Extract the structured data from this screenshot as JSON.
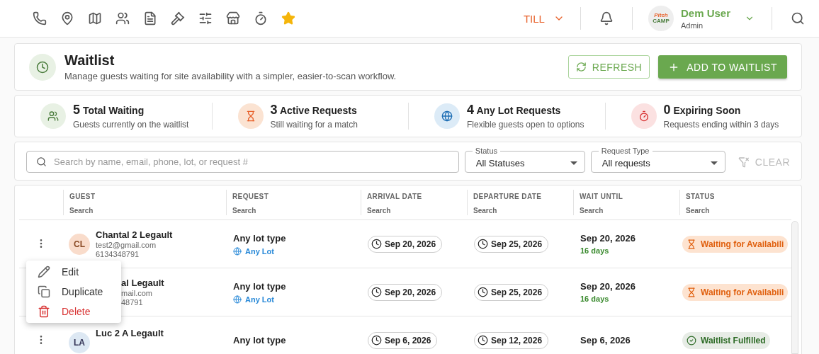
{
  "topbar": {
    "till": "TILL",
    "user": {
      "name": "Dem User",
      "role": "Admin",
      "logo_top": "Pitch",
      "logo_bottom": "CAMP"
    }
  },
  "header": {
    "title": "Waitlist",
    "subtitle": "Manage guests waiting for site availability with a simpler, easier-to-scan workflow.",
    "refresh": "REFRESH",
    "add": "ADD TO WAITLIST"
  },
  "stats": [
    {
      "kind": "group",
      "count": "5",
      "label": "Total Waiting",
      "caption": "Guests currently on the waitlist",
      "color": "#e8f1e4"
    },
    {
      "kind": "hourglass",
      "count": "3",
      "label": "Active Requests",
      "caption": "Still waiting for a match",
      "color": "#fbe3d2"
    },
    {
      "kind": "globe",
      "count": "4",
      "label": "Any Lot Requests",
      "caption": "Flexible guests open to options",
      "color": "#dcebf7"
    },
    {
      "kind": "timer",
      "count": "0",
      "label": "Expiring Soon",
      "caption": "Requests ending within 3 days",
      "color": "#fbe1e1"
    }
  ],
  "filters": {
    "search_placeholder": "Search by name, email, phone, lot, or request #",
    "status": {
      "label": "Status",
      "value": "All Statuses"
    },
    "request_type": {
      "label": "Request Type",
      "value": "All requests"
    },
    "clear": "CLEAR"
  },
  "table": {
    "columns": [
      {
        "title": "GUEST",
        "filter": "Search"
      },
      {
        "title": "REQUEST",
        "filter": "Search"
      },
      {
        "title": "ARRIVAL DATE",
        "filter": "Search"
      },
      {
        "title": "DEPARTURE DATE",
        "filter": "Search"
      },
      {
        "title": "WAIT UNTIL",
        "filter": "Search"
      },
      {
        "title": "STATUS",
        "filter": "Search"
      }
    ],
    "rows": [
      {
        "initials": "CL",
        "name": "Chantal 2 Legault",
        "email": "test2@gmail.com",
        "phone": "6134348791",
        "request": "Any lot type",
        "lot": "Any Lot",
        "arrival": "Sep 20, 2026",
        "departure": "Sep 25, 2026",
        "wait_until": "Sep 20, 2026",
        "wait_left": "16 days",
        "status": {
          "kind": "waiting",
          "label": "Waiting for Availabili"
        }
      },
      {
        "name": "al Legault",
        "email": "mail.com",
        "phone": "48791",
        "request": "Any lot type",
        "lot": "Any Lot",
        "arrival": "Sep 20, 2026",
        "departure": "Sep 25, 2026",
        "wait_until": "Sep 20, 2026",
        "wait_left": "16 days",
        "status": {
          "kind": "waiting",
          "label": "Waiting for Availabili"
        }
      },
      {
        "initials": "LA",
        "name": "Luc 2 A Legault",
        "request": "Any lot type",
        "arrival": "Sep 6, 2026",
        "departure": "Sep 12, 2026",
        "wait_until": "Sep 6, 2026",
        "status": {
          "kind": "fulfilled",
          "label": "Waitlist Fulfilled"
        }
      }
    ]
  },
  "row_menu": [
    {
      "kind": "edit",
      "label": "Edit"
    },
    {
      "kind": "duplicate",
      "label": "Duplicate"
    },
    {
      "kind": "delete",
      "label": "Delete"
    }
  ]
}
